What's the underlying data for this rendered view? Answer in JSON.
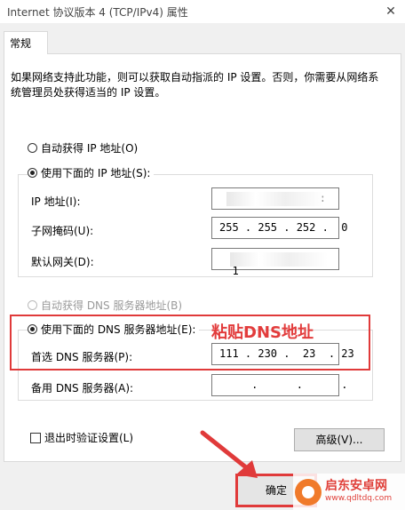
{
  "window": {
    "title": "Internet 协议版本 4 (TCP/IPv4) 属性",
    "close_glyph": "✕"
  },
  "tabs": [
    {
      "label": "常规"
    }
  ],
  "description": "如果网络支持此功能，则可以获取自动指派的 IP 设置。否则，你需要从网络系统管理员处获得适当的 IP 设置。",
  "ip_section": {
    "auto_label": "自动获得 IP 地址(O)",
    "manual_label": "使用下面的 IP 地址(S):",
    "fields": [
      {
        "label": "IP 地址(I):",
        "value": ":"
      },
      {
        "label": "子网掩码(U):",
        "value": "255 . 255 . 252 .  0"
      },
      {
        "label": "默认网关(D):",
        "value": "1"
      }
    ]
  },
  "dns_section": {
    "auto_label": "自动获得 DNS 服务器地址(B)",
    "manual_label": "使用下面的 DNS 服务器地址(E):",
    "fields": [
      {
        "label": "首选 DNS 服务器(P):",
        "value": "111 . 230 .  23  . 23"
      },
      {
        "label": "备用 DNS 服务器(A):",
        "value": "     .      .      ."
      }
    ]
  },
  "annotation": {
    "paste_note": "粘贴DNS地址",
    "accent_color": "#e03a3a"
  },
  "validate_label": "退出时验证设置(L)",
  "advanced_button": "高级(V)...",
  "ok_button": "确定",
  "watermark": {
    "title": "启东安卓网",
    "url": "www.qdltdq.com"
  }
}
